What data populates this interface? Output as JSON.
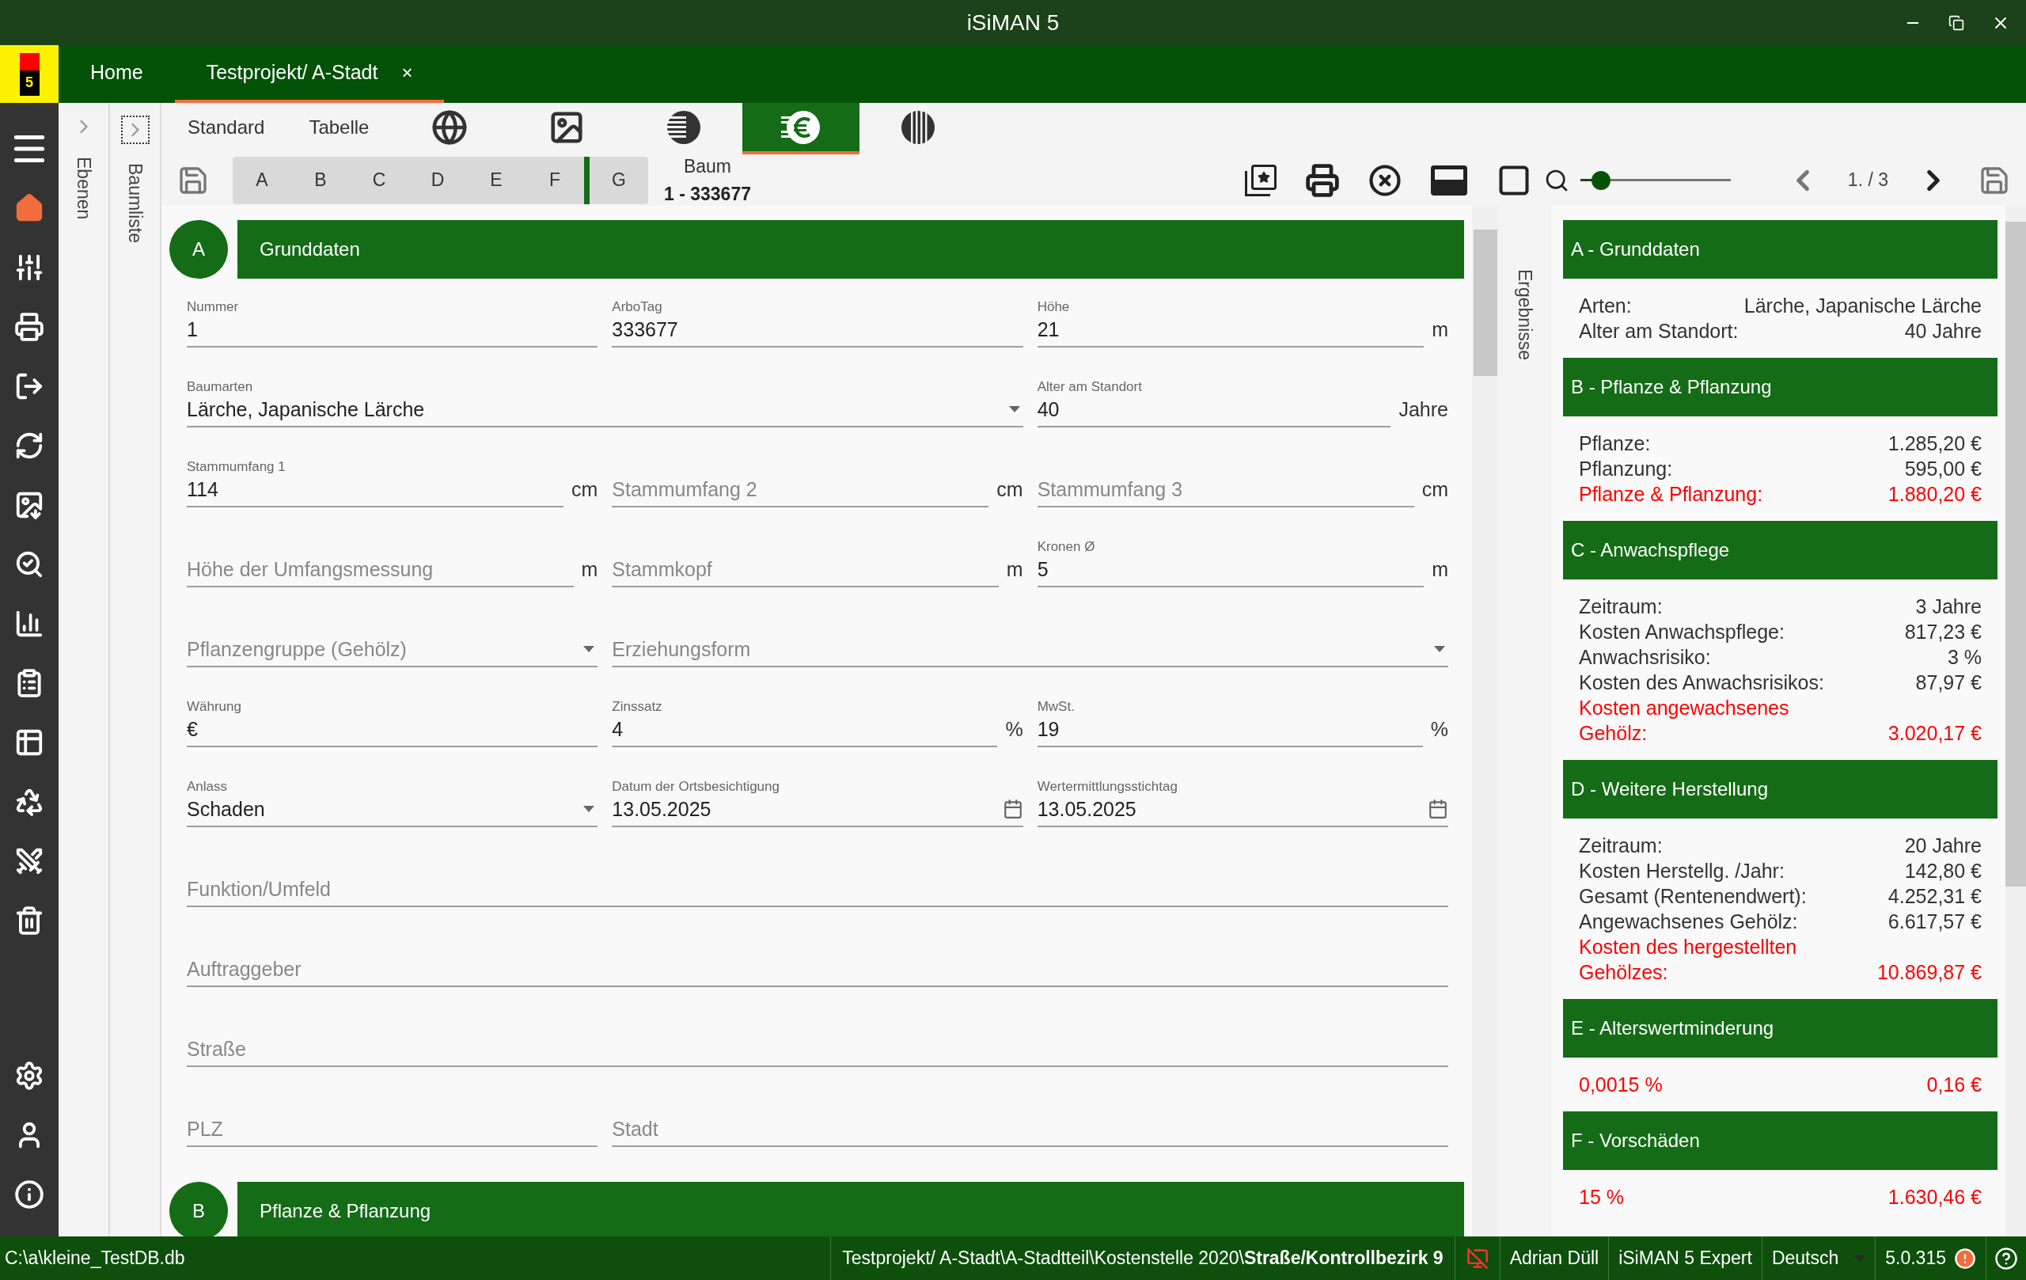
{
  "window": {
    "title": "iSiMAN 5"
  },
  "logo": {
    "text": "5"
  },
  "tabs": [
    {
      "label": "Home",
      "selected": false
    },
    {
      "label": "Testprojekt/ A-Stadt",
      "selected": true,
      "close": "×"
    }
  ],
  "nav": {
    "items": [
      {
        "kind": "menu",
        "selected": false
      },
      {
        "kind": "home",
        "selected": true
      },
      {
        "kind": "sliders",
        "selected": false
      },
      {
        "kind": "print",
        "selected": false
      },
      {
        "kind": "export",
        "selected": false
      },
      {
        "kind": "sync",
        "selected": false
      },
      {
        "kind": "image",
        "selected": false
      },
      {
        "kind": "search",
        "selected": false
      },
      {
        "kind": "chart",
        "selected": false
      },
      {
        "kind": "clipboard",
        "selected": false
      },
      {
        "kind": "table",
        "selected": false
      },
      {
        "kind": "recycle",
        "selected": false
      },
      {
        "kind": "tools",
        "selected": false
      },
      {
        "kind": "trash",
        "selected": false
      }
    ],
    "bottom": [
      {
        "kind": "settings"
      },
      {
        "kind": "user"
      },
      {
        "kind": "info"
      }
    ]
  },
  "side_panels": [
    "Ebenen",
    "Baumliste"
  ],
  "view_tabs": [
    {
      "kind": "text",
      "label": "Standard",
      "selected": false
    },
    {
      "kind": "text",
      "label": "Tabelle",
      "selected": false
    },
    {
      "kind": "globe",
      "selected": false
    },
    {
      "kind": "photo",
      "selected": false
    },
    {
      "kind": "head",
      "selected": false
    },
    {
      "kind": "euro",
      "selected": true
    },
    {
      "kind": "lines",
      "selected": false
    }
  ],
  "section_tabs": [
    {
      "label": "A",
      "marked": false
    },
    {
      "label": "B",
      "marked": false
    },
    {
      "label": "C",
      "marked": false
    },
    {
      "label": "D",
      "marked": false
    },
    {
      "label": "E",
      "marked": false
    },
    {
      "label": "F",
      "marked": true
    },
    {
      "label": "G",
      "marked": false
    }
  ],
  "record": {
    "label": "Baum",
    "value": "1 - 333677"
  },
  "zoom": {
    "level": 0.14
  },
  "pager": {
    "text": "1. / 3"
  },
  "form": {
    "sections": [
      {
        "letter": "A",
        "title": "Grunddaten",
        "rows": [
          {
            "kind": "thirds",
            "fields": [
              {
                "kind": "text",
                "label": "Nummer",
                "value": "1"
              },
              {
                "kind": "text",
                "label": "ArboTag",
                "value": "333677"
              },
              {
                "kind": "text",
                "label": "Höhe",
                "value": "21",
                "unit": "m"
              }
            ]
          },
          {
            "kind": "wide-first",
            "fields": [
              {
                "kind": "select",
                "label": "Baumarten",
                "value": "Lärche, Japanische Lärche"
              },
              {
                "kind": "text",
                "label": "Alter am Standort",
                "value": "40",
                "unit": "Jahre"
              }
            ]
          },
          {
            "kind": "thirds",
            "fields": [
              {
                "kind": "text",
                "label": "Stammumfang 1",
                "value": "114",
                "unit": "cm"
              },
              {
                "kind": "text",
                "placeholder": "Stammumfang 2",
                "unit": "cm"
              },
              {
                "kind": "text",
                "placeholder": "Stammumfang 3",
                "unit": "cm"
              }
            ]
          },
          {
            "kind": "thirds",
            "fields": [
              {
                "kind": "text",
                "placeholder": "Höhe der Umfangsmessung",
                "unit": "m"
              },
              {
                "kind": "text",
                "placeholder": "Stammkopf",
                "unit": "m"
              },
              {
                "kind": "text",
                "label": "Kronen Ø",
                "value": "5",
                "unit": "m"
              }
            ]
          },
          {
            "kind": "wide-last",
            "fields": [
              {
                "kind": "select",
                "placeholder": "Pflanzengruppe (Gehölz)"
              },
              {
                "kind": "select",
                "placeholder": "Erziehungsform"
              }
            ]
          },
          {
            "kind": "thirds",
            "fields": [
              {
                "kind": "text",
                "label": "Währung",
                "value": "€"
              },
              {
                "kind": "text",
                "label": "Zinssatz",
                "value": "4",
                "unit": "%"
              },
              {
                "kind": "text",
                "label": "MwSt.",
                "value": "19",
                "unit": "%"
              }
            ]
          },
          {
            "kind": "thirds",
            "fields": [
              {
                "kind": "select",
                "label": "Anlass",
                "value": "Schaden"
              },
              {
                "kind": "date",
                "label": "Datum der Ortsbesichtigung",
                "value": "13.05.2025"
              },
              {
                "kind": "date",
                "label": "Wertermittlungsstichtag",
                "value": "13.05.2025"
              }
            ]
          },
          {
            "kind": "full",
            "fields": [
              {
                "kind": "text",
                "placeholder": "Funktion/Umfeld"
              }
            ]
          },
          {
            "kind": "full",
            "fields": [
              {
                "kind": "text",
                "placeholder": "Auftraggeber"
              }
            ]
          },
          {
            "kind": "full",
            "fields": [
              {
                "kind": "text",
                "placeholder": "Straße"
              }
            ]
          },
          {
            "kind": "wide-last",
            "fields": [
              {
                "kind": "text",
                "placeholder": "PLZ"
              },
              {
                "kind": "text",
                "placeholder": "Stadt"
              }
            ]
          }
        ]
      },
      {
        "letter": "B",
        "title": "Pflanze & Pflanzung"
      }
    ]
  },
  "results": {
    "label": "Ergebnisse",
    "sections": [
      {
        "title": "A - Grunddaten",
        "rows": [
          {
            "label": "Arten:",
            "value": "Lärche, Japanische Lärche",
            "highlight": false
          },
          {
            "label": "Alter am Standort:",
            "value": "40 Jahre",
            "highlight": false
          }
        ]
      },
      {
        "title": "B - Pflanze & Pflanzung",
        "rows": [
          {
            "label": "Pflanze:",
            "value": "1.285,20 €",
            "highlight": false
          },
          {
            "label": "Pflanzung:",
            "value": "595,00 €",
            "highlight": false
          },
          {
            "label": "Pflanze & Pflanzung:",
            "value": "1.880,20 €",
            "highlight": true
          }
        ]
      },
      {
        "title": "C - Anwachspflege",
        "rows": [
          {
            "label": "Zeitraum:",
            "value": "3 Jahre",
            "highlight": false
          },
          {
            "label": "Kosten Anwachspflege:",
            "value": "817,23 €",
            "highlight": false
          },
          {
            "label": "Anwachsrisiko:",
            "value": "3 %",
            "highlight": false
          },
          {
            "label": "Kosten des Anwachsrisikos:",
            "value": "87,97 €",
            "highlight": false
          },
          {
            "label": "Kosten angewachsenes Gehölz:",
            "value": "3.020,17 €",
            "highlight": true
          }
        ]
      },
      {
        "title": "D - Weitere Herstellung",
        "rows": [
          {
            "label": "Zeitraum:",
            "value": "20 Jahre",
            "highlight": false
          },
          {
            "label": "Kosten Herstellg. /Jahr:",
            "value": "142,80 €",
            "highlight": false
          },
          {
            "label": "Gesamt (Rentenendwert):",
            "value": "4.252,31 €",
            "highlight": false
          },
          {
            "label": "Angewachsenes Gehölz:",
            "value": "6.617,57 €",
            "highlight": false
          },
          {
            "label": "Kosten des hergestellten Gehölzes:",
            "value": "10.869,87 €",
            "highlight": true
          }
        ]
      },
      {
        "title": "E - Alterswertminderung",
        "rows": [
          {
            "label": "0,0015 %",
            "value": "0,16 €",
            "highlight": true
          }
        ]
      },
      {
        "title": "F - Vorschäden",
        "rows": [
          {
            "label": "15 %",
            "value": "1.630,46 €",
            "highlight": true
          }
        ]
      }
    ]
  },
  "status_bar": {
    "path": "C:\\a\\kleine_TestDB.db",
    "breadcrumb": "Testprojekt/ A-Stadt\\A-Stadtteil\\Kostenstelle 2020\\**Straße/Kontrollbezirk 9**",
    "offline": true,
    "user": "Adrian Düll",
    "edition": "iSiMAN 5 Expert",
    "language": "Deutsch",
    "version": "5.0.315",
    "warning": true
  }
}
